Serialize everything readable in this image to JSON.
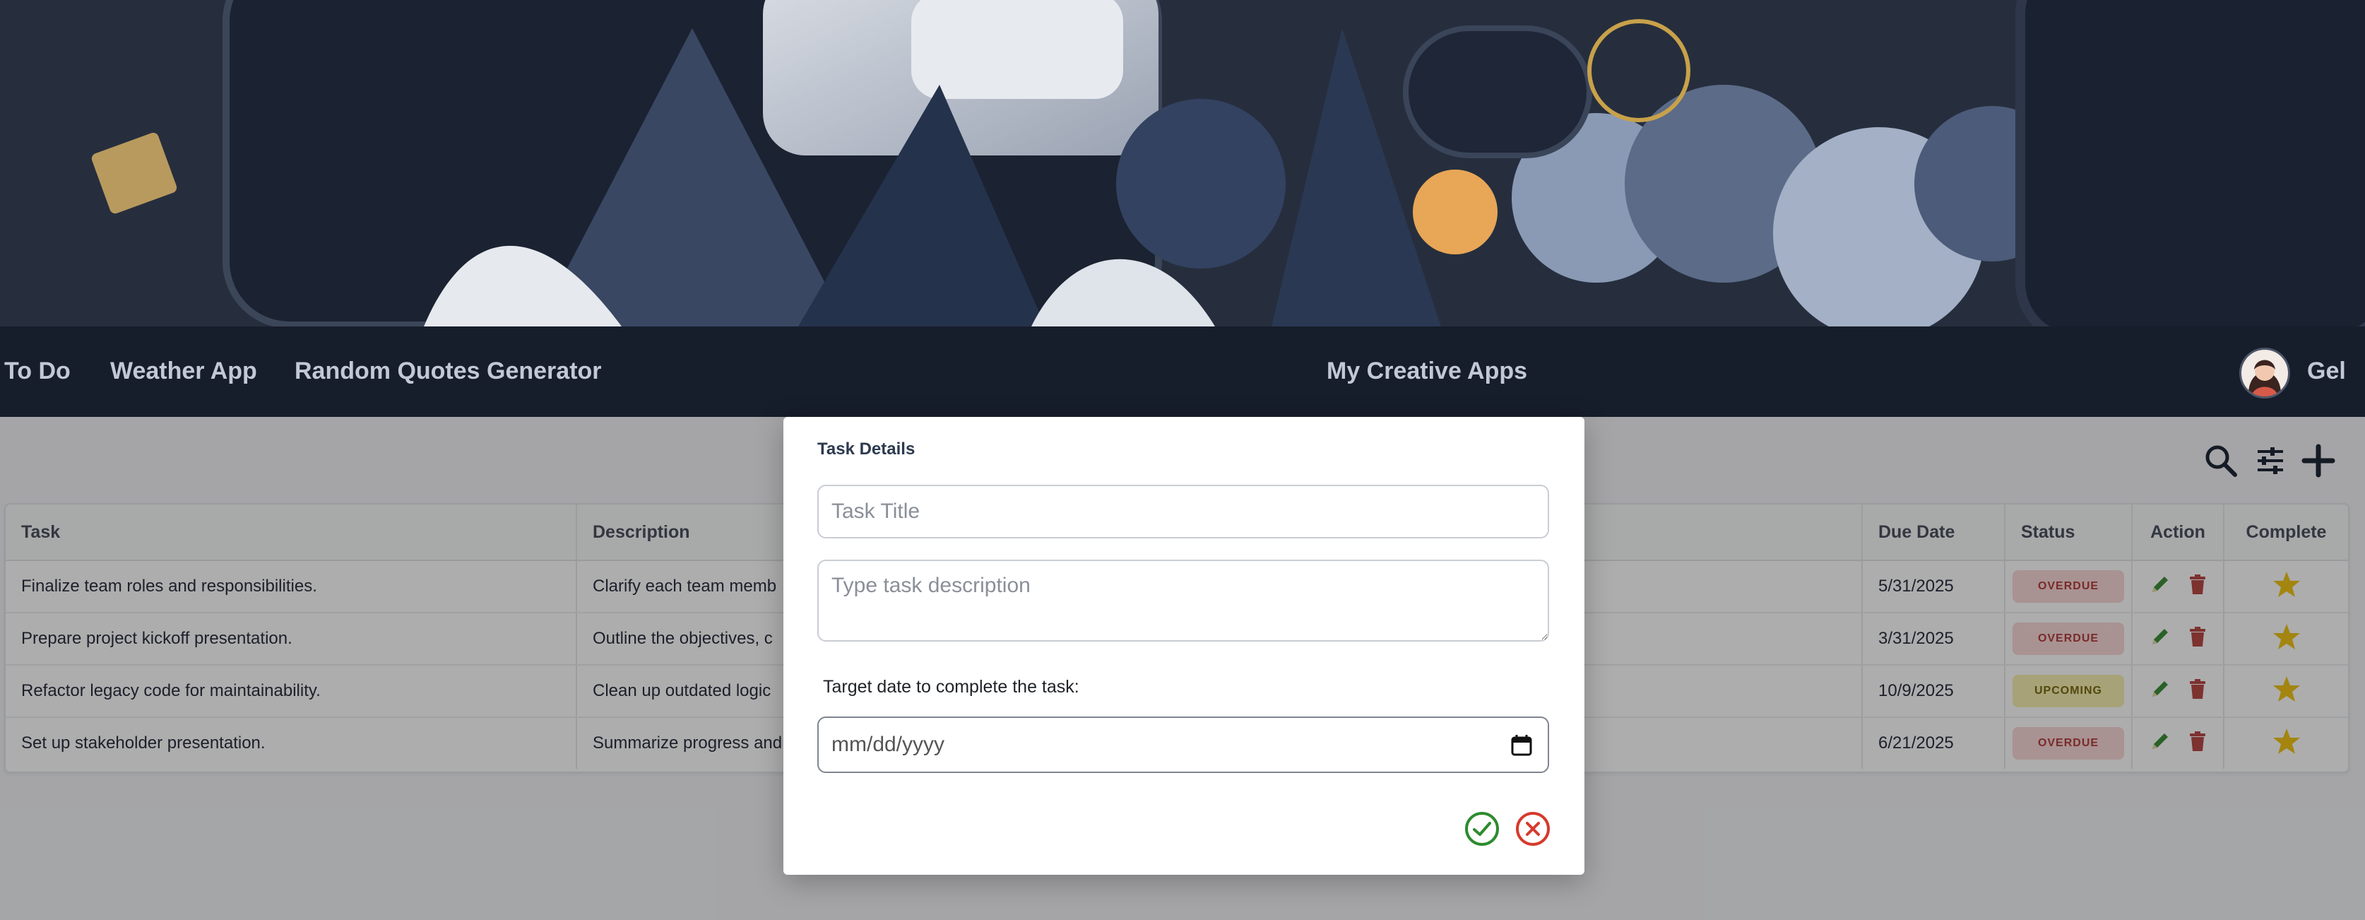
{
  "nav": {
    "links": [
      "To Do",
      "Weather App",
      "Random Quotes Generator"
    ],
    "brand": "My Creative Apps",
    "user": "Gel"
  },
  "toolbar": {
    "icons": [
      "search-icon",
      "filter-sliders-icon",
      "plus-icon"
    ]
  },
  "table": {
    "headers": [
      "Task",
      "Description",
      "Due Date",
      "Status",
      "Action",
      "Complete"
    ],
    "rows": [
      {
        "task": "Finalize team roles and responsibilities.",
        "description": "Clarify each team memb",
        "due": "5/31/2025",
        "status": "OVERDUE"
      },
      {
        "task": "Prepare project kickoff presentation.",
        "description": "Outline the objectives, c",
        "due": "3/31/2025",
        "status": "OVERDUE"
      },
      {
        "task": "Refactor legacy code for maintainability.",
        "description": "Clean up outdated logic",
        "due": "10/9/2025",
        "status": "UPCOMING"
      },
      {
        "task": "Set up stakeholder presentation.",
        "description": "Summarize progress and",
        "due": "6/21/2025",
        "status": "OVERDUE"
      }
    ]
  },
  "modal": {
    "title": "Task Details",
    "title_placeholder": "Task Title",
    "description_placeholder": "Type task description",
    "date_label": "Target date to complete the task:",
    "date_placeholder": "mm/dd/yyyy"
  },
  "colors": {
    "navbar": "#161d2b",
    "overdue_bg": "#f9d7d7",
    "upcoming_bg": "#f6efb0",
    "confirm": "#2e8b2e",
    "cancel": "#d63a2c",
    "star": "#f0c419"
  }
}
